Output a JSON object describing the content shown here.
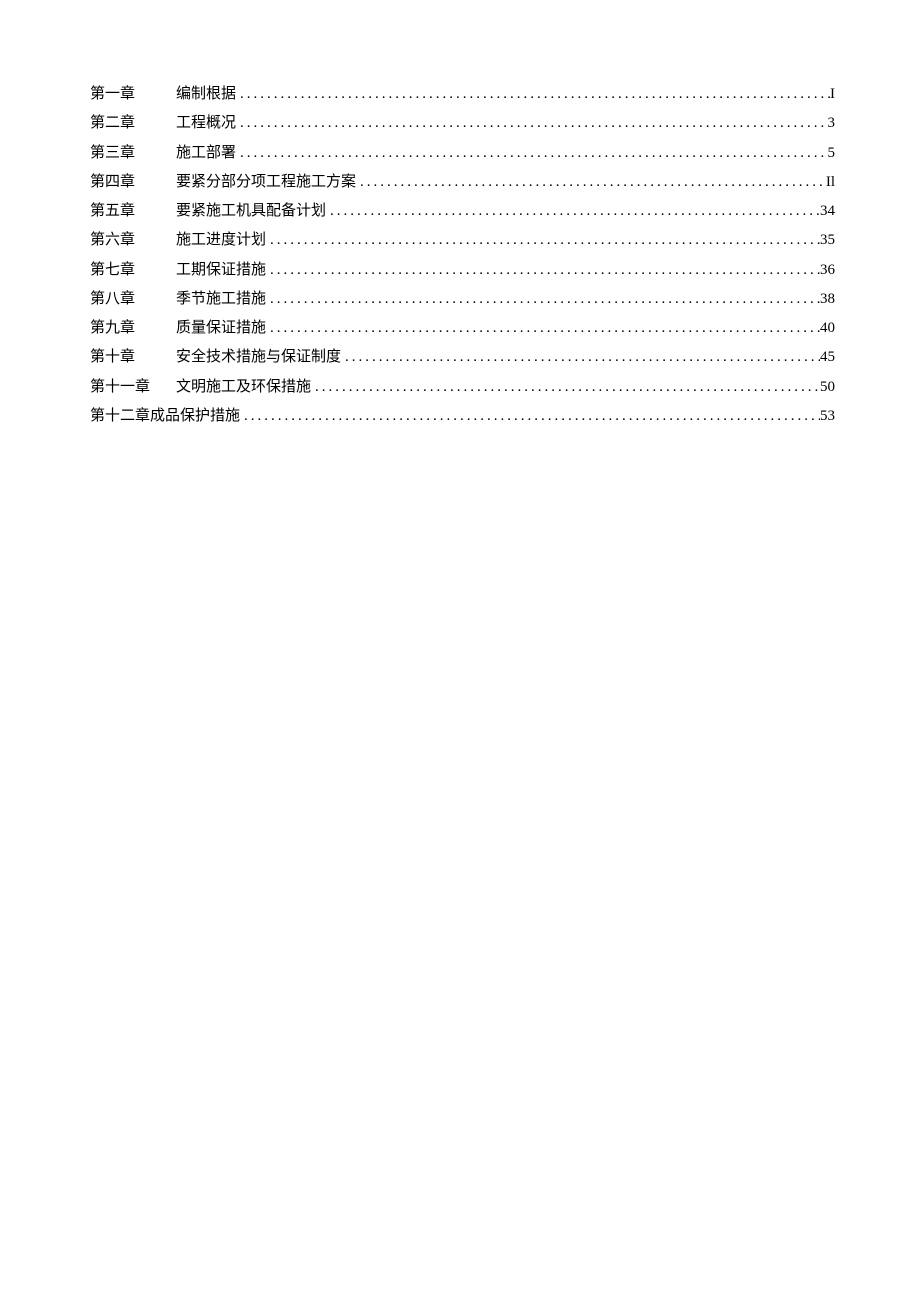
{
  "toc": {
    "entries": [
      {
        "chapter": "第一章",
        "title": "编制根据",
        "page": "I",
        "spaced": true
      },
      {
        "chapter": "第二章",
        "title": "工程概况",
        "page": "3",
        "spaced": true
      },
      {
        "chapter": "第三章",
        "title": "施工部署",
        "page": "5",
        "spaced": true
      },
      {
        "chapter": "第四章",
        "title": "要紧分部分项工程施工方案",
        "page": "Il",
        "spaced": true
      },
      {
        "chapter": "第五章",
        "title": "要紧施工机具配备计划",
        "page": "34",
        "spaced": true
      },
      {
        "chapter": "第六章",
        "title": "施工进度计划",
        "page": "35",
        "spaced": true
      },
      {
        "chapter": "第七章",
        "title": "工期保证措施",
        "page": "36",
        "spaced": true
      },
      {
        "chapter": "第八章",
        "title": "季节施工措施",
        "page": "38",
        "spaced": true
      },
      {
        "chapter": "第九章",
        "title": "质量保证措施",
        "page": "40",
        "spaced": true
      },
      {
        "chapter": "第十章",
        "title": "安全技术措施与保证制度",
        "page": "45",
        "spaced": true
      },
      {
        "chapter": "第十一章",
        "title": "文明施工及环保措施",
        "page": "50",
        "spaced": true
      },
      {
        "chapter": "第十二章",
        "title": "成品保护措施",
        "page": "53",
        "spaced": false
      }
    ]
  }
}
